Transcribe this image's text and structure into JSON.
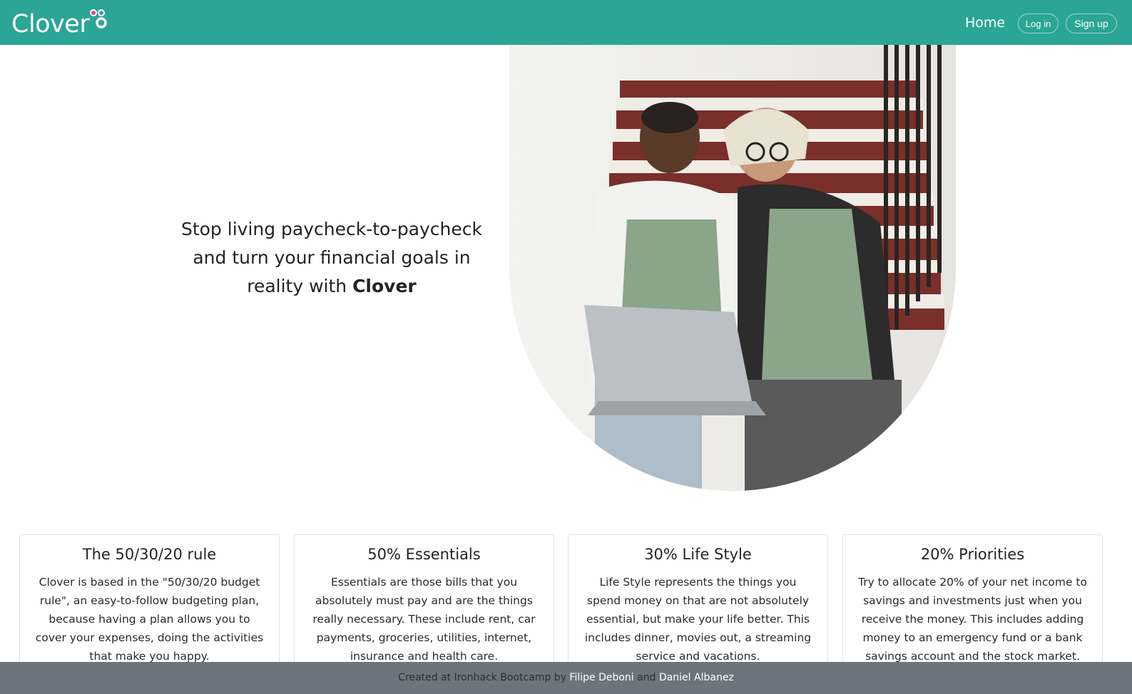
{
  "app": {
    "name": "Clover"
  },
  "nav": {
    "home_label": "Home",
    "login_label": "Log in",
    "signup_label": "Sign up"
  },
  "hero": {
    "text_lines": [
      "Stop living paycheck-to-paycheck",
      "and turn your financial goals in",
      "reality with "
    ],
    "brand_word": "Clover",
    "image_icon": "people-with-laptop-photo"
  },
  "cards": [
    {
      "title": "The 50/30/20 rule",
      "body": "Clover is based in the \"50/30/20 budget rule\", an easy-to-follow budgeting plan, because having a plan allows you to cover your expenses, doing the activities that make you happy."
    },
    {
      "title": "50% Essentials",
      "body": "Essentials are those bills that you absolutely must pay and are the things really necessary. These include rent, car payments, groceries, utilities, internet, insurance and health care."
    },
    {
      "title": "30% Life Style",
      "body": "Life Style represents the things you spend money on that are not absolutely essential, but make your life better. This includes dinner, movies out, a streaming service and vacations."
    },
    {
      "title": "20% Priorities",
      "body": "Try to allocate 20% of your net income to savings and investments just when you receive the money. This includes adding money to an emergency fund or a bank savings account and the stock market."
    }
  ],
  "footer": {
    "prefix": "Created at Ironhack Bootcamp by ",
    "author1": "Filipe Deboni",
    "joiner": " and ",
    "author2": "Daniel Albanez"
  },
  "colors": {
    "brand": "#2ba596",
    "footer": "#6c757d",
    "logo_pink": "#e8456b",
    "logo_blue": "#4a90d9"
  }
}
